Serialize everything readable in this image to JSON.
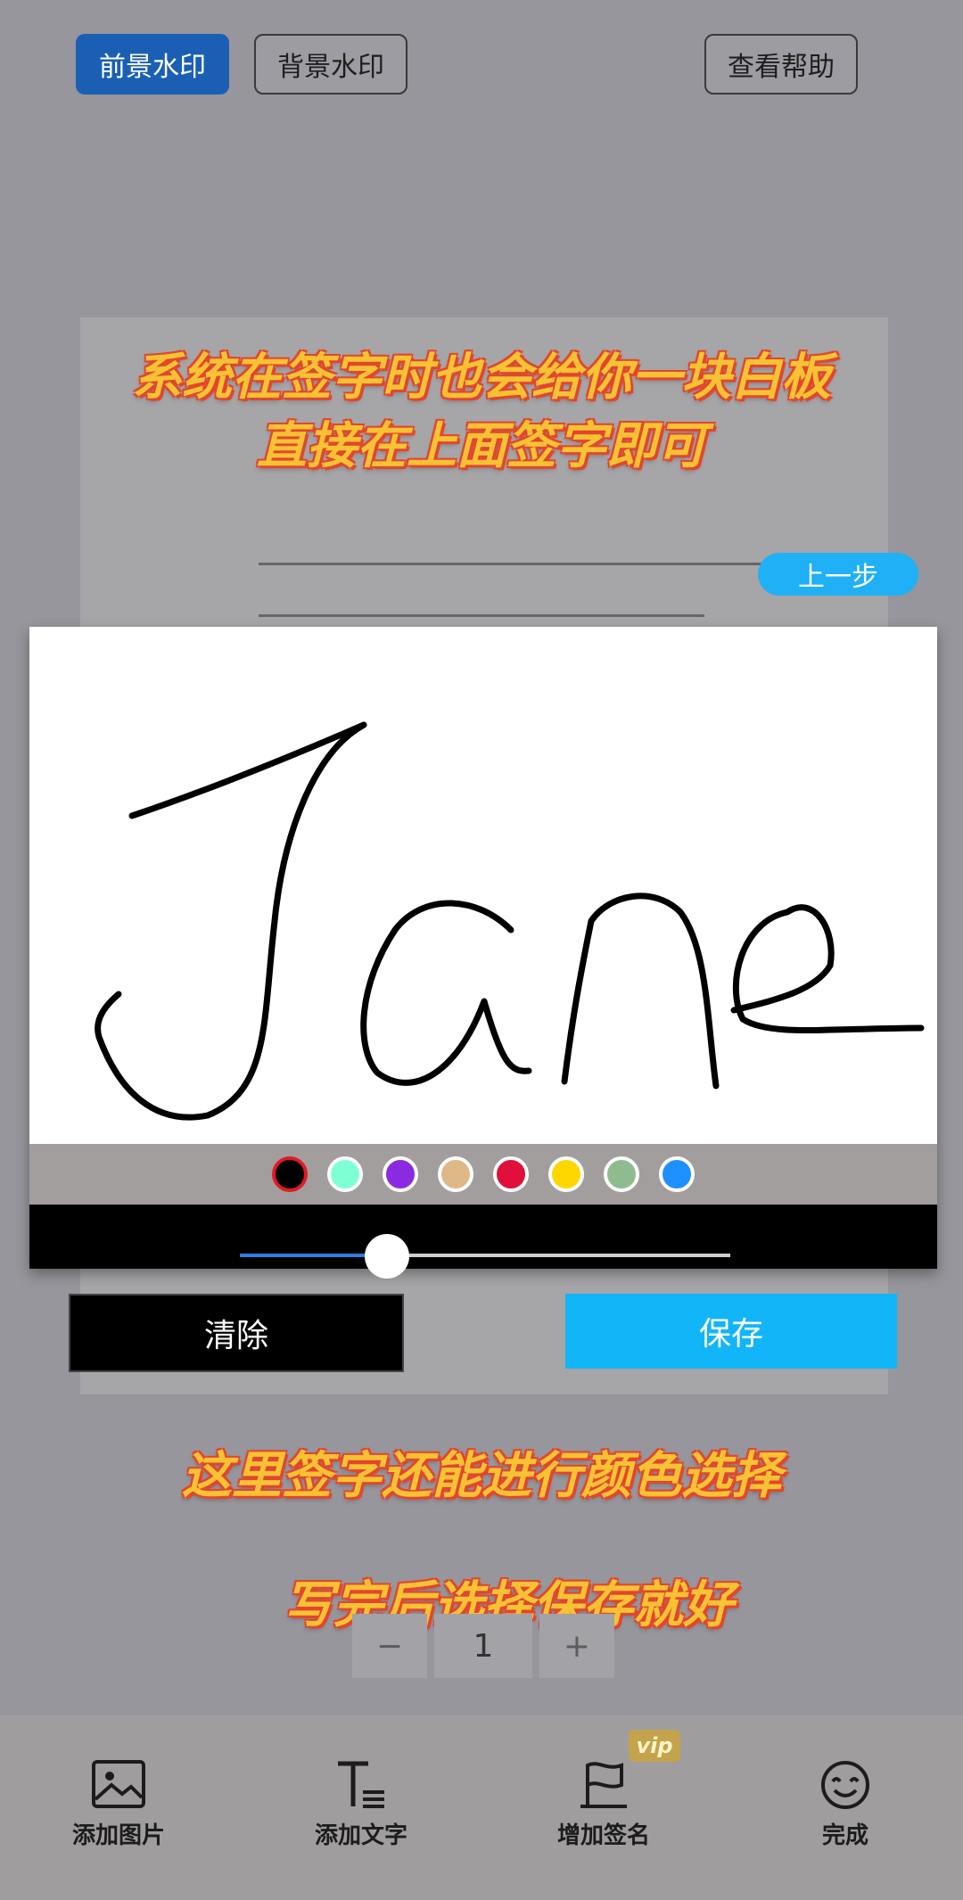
{
  "top_buttons": {
    "foreground": "前景水印",
    "background": "背景水印",
    "help": "查看帮助"
  },
  "overlay": {
    "line1": "系统在签字时也会给你一块白板",
    "line2": "直接在上面签字即可",
    "line3": "这里签字还能进行颜色选择",
    "line4": "写完后选择保存就好"
  },
  "signature_pad": {
    "prev_step": "上一步",
    "colors": [
      "#000000",
      "#7fffd4",
      "#8a2be2",
      "#deb887",
      "#e0103a",
      "#ffd700",
      "#8fbc8f",
      "#1e90ff"
    ],
    "selected_color": "#000000",
    "stroke_width_fraction": 0.3,
    "clear": "清除",
    "save": "保存"
  },
  "stepper": {
    "minus": "−",
    "value": "1",
    "plus": "+"
  },
  "bottom_tabs": [
    {
      "label": "添加图片",
      "icon": "image-icon"
    },
    {
      "label": "添加文字",
      "icon": "text-icon"
    },
    {
      "label": "增加签名",
      "icon": "signature-flag-icon",
      "badge": "vip"
    },
    {
      "label": "完成",
      "icon": "smile-icon"
    }
  ]
}
